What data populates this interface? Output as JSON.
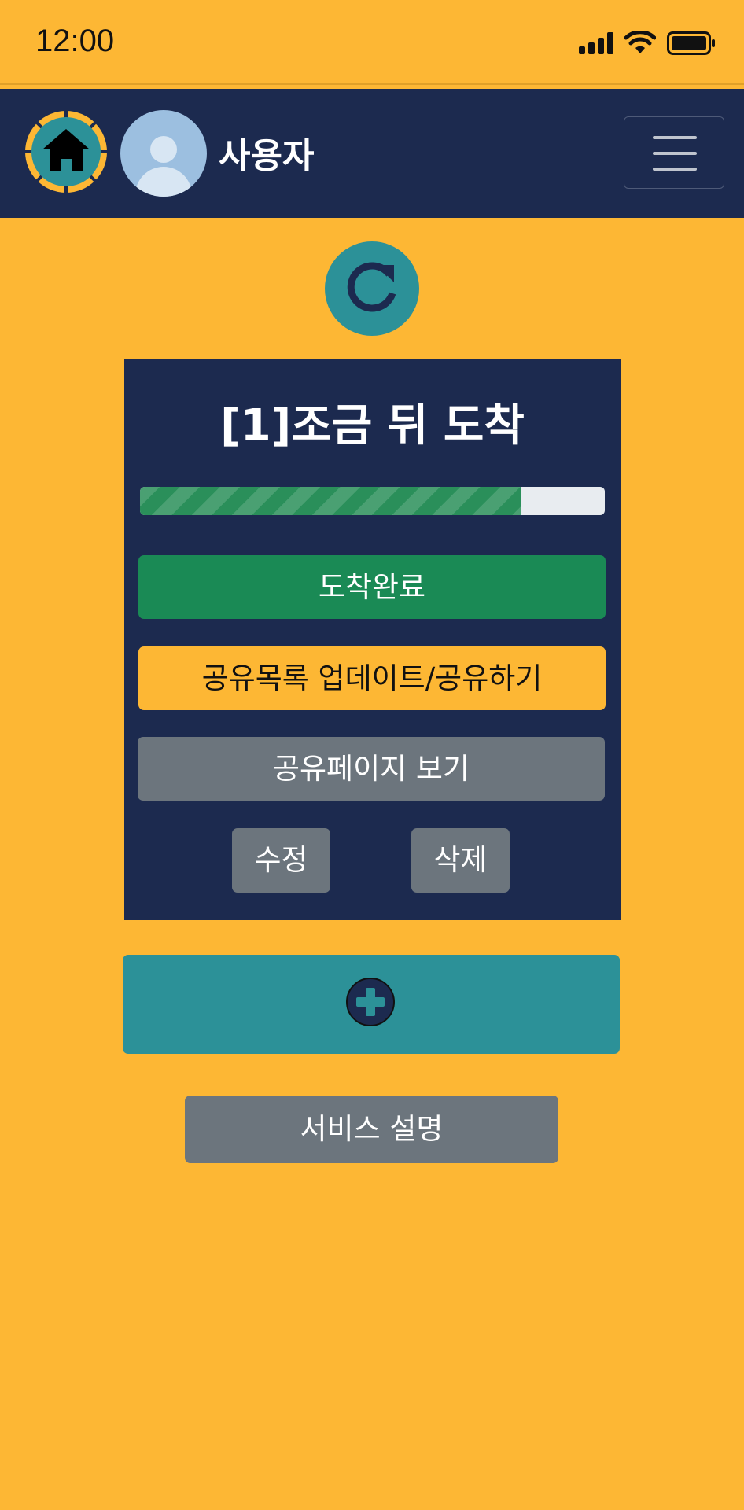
{
  "status_bar": {
    "time": "12:00"
  },
  "navbar": {
    "user_name": "사용자"
  },
  "card": {
    "title": "[1]조금 뒤 도착",
    "progress_percent": 82,
    "arrive_label": "도착완료",
    "share_update_label": "공유목록 업데이트/공유하기",
    "share_view_label": "공유페이지 보기",
    "edit_label": "수정",
    "delete_label": "삭제"
  },
  "service_label": "서비스 설명",
  "colors": {
    "background": "#FDB734",
    "navy": "#1C2A4F",
    "teal": "#2C9198",
    "success": "#1A8A55",
    "secondary": "#6C757D"
  }
}
